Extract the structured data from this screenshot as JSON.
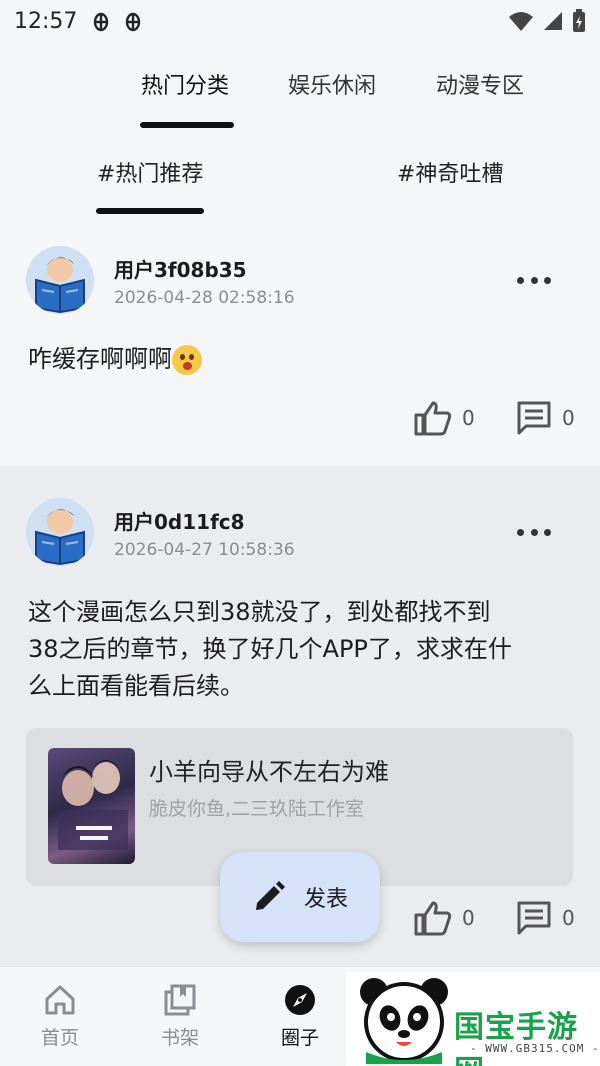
{
  "status_bar": {
    "time": "12:57"
  },
  "top_tabs": [
    {
      "label": "热门分类",
      "active": true
    },
    {
      "label": "娱乐休闲",
      "active": false
    },
    {
      "label": "动漫专区",
      "active": false
    }
  ],
  "sub_tabs": [
    {
      "label": "#热门推荐",
      "active": true
    },
    {
      "label": "#神奇吐槽",
      "active": false
    }
  ],
  "posts": [
    {
      "username": "用户3f08b35",
      "timestamp": "2026-04-28 02:58:16",
      "content": "咋缓存啊啊啊",
      "likes": "0",
      "comments": "0"
    },
    {
      "username": "用户0d11fc8",
      "timestamp": "2026-04-27 10:58:36",
      "content_lines": [
        "这个漫画怎么只到38就没了，到处都找不到",
        "38之后的章节，换了好几个APP了，求求在什",
        "么上面看能看后续。"
      ],
      "book": {
        "title": "小羊向导从不左右为难",
        "author": "脆皮你鱼,二三玖陆工作室"
      },
      "likes": "0",
      "comments": "0"
    }
  ],
  "fab": {
    "label": "发表"
  },
  "bottom_nav": [
    {
      "label": "首页",
      "icon": "home-icon",
      "active": false
    },
    {
      "label": "书架",
      "icon": "bookshelf-icon",
      "active": false
    },
    {
      "label": "圈子",
      "icon": "compass-icon",
      "active": true
    }
  ],
  "watermark": {
    "text": "国宝手游网",
    "url": "- WWW.GB315.COM -"
  },
  "colors": {
    "accent": "#111111",
    "fab_bg": "#d6e2f7",
    "card_bg": "#dddee1",
    "watermark_green": "#16a34a"
  }
}
